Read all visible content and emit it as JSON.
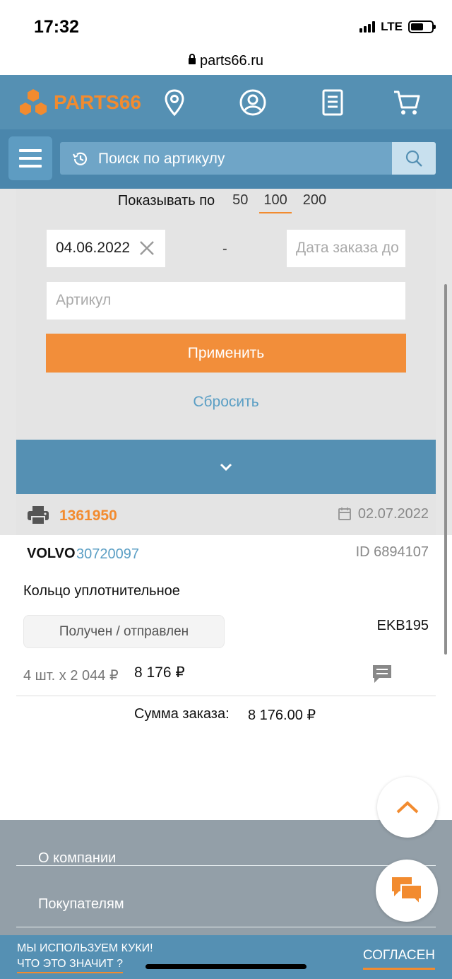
{
  "status_bar": {
    "time": "17:32",
    "network": "LTE",
    "battery_level": 0.6
  },
  "browser": {
    "url": "parts66.ru"
  },
  "header": {
    "logo_text": "PARTS66",
    "icons": [
      "location-icon",
      "account-icon",
      "orders-icon",
      "cart-icon"
    ],
    "brand_color": "#f28b2f",
    "bar_color": "#5590b3"
  },
  "search": {
    "placeholder": "Поиск по артикулу"
  },
  "filter": {
    "show_by_label": "Показывать по",
    "show_by_options": [
      "50",
      "100",
      "200"
    ],
    "show_by_selected": "100",
    "date_from": "04.06.2022",
    "date_separator": "-",
    "date_to_placeholder": "Дата заказа до",
    "article_placeholder": "Артикул",
    "apply_label": "Применить",
    "reset_label": "Сбросить"
  },
  "order": {
    "number": "1361950",
    "date": "02.07.2022",
    "item": {
      "brand": "VOLVO",
      "part_number": "30720097",
      "id_text": "ID 6894107",
      "name": "Кольцо уплотнительное",
      "status": "Получен / отправлен",
      "warehouse": "EKB195",
      "qty_price": "4 шт. x 2 044 ₽",
      "line_total": "8 176 ₽"
    },
    "sum_label": "Сумма заказа:",
    "sum_value": "8 176.00 ₽"
  },
  "footer": {
    "links": [
      "О компании",
      "Покупателям"
    ]
  },
  "cookie": {
    "line1": "МЫ ИСПОЛЬЗУЕМ КУКИ!",
    "line2": "ЧТО ЭТО ЗНАЧИТ ?",
    "agree": "СОГЛАСЕН"
  }
}
